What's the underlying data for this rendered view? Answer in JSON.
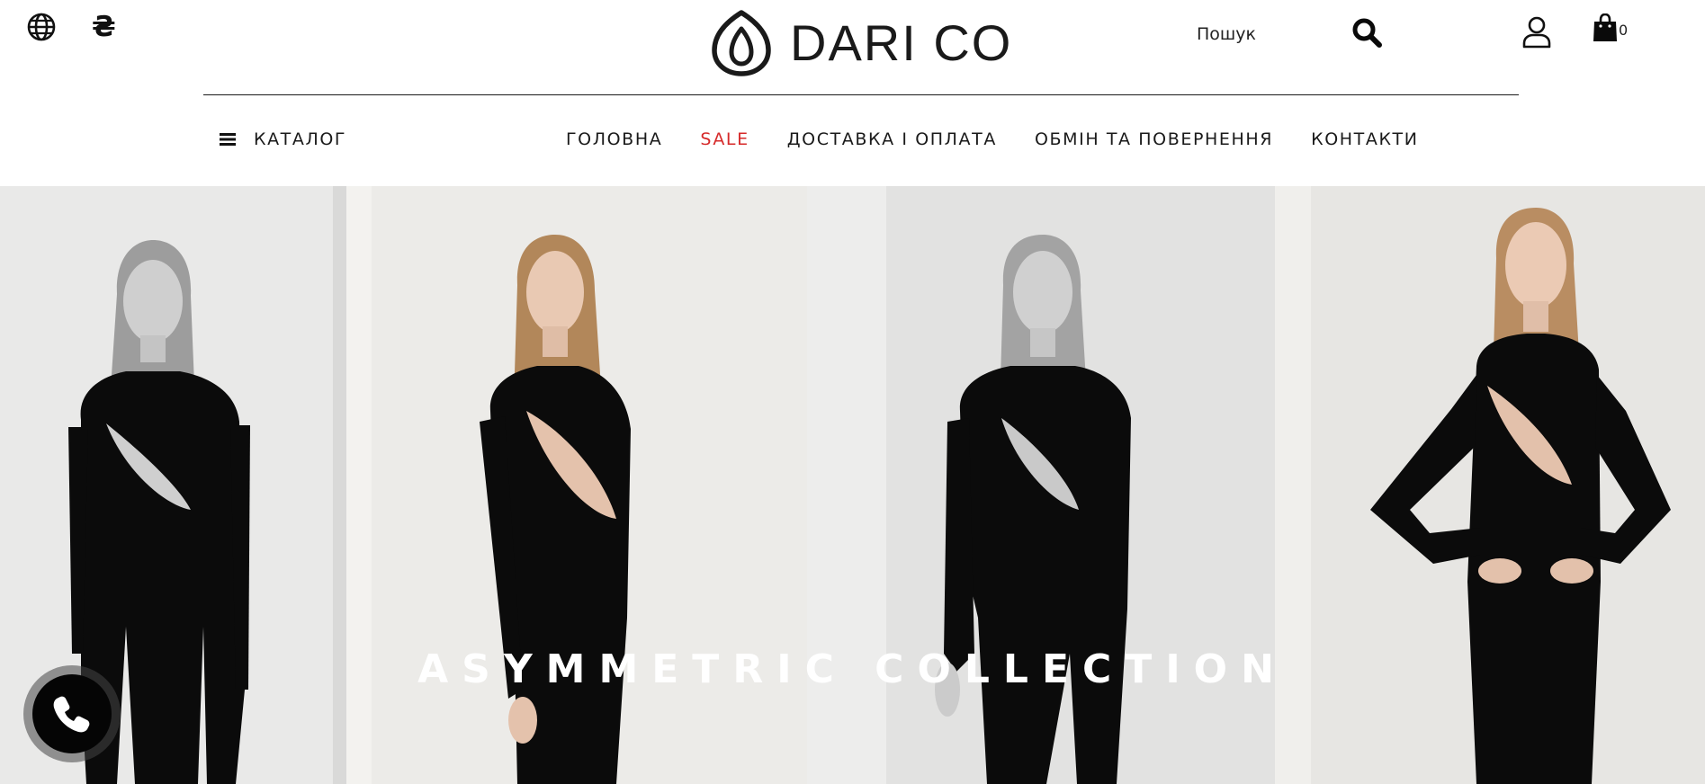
{
  "brand": {
    "name": "DARI CO"
  },
  "header": {
    "language_icon": "globe-icon",
    "currency_symbol": "₴",
    "search_label": "Пошук",
    "cart_count": "0"
  },
  "nav": {
    "catalog_label": "КАТАЛОГ",
    "items": [
      {
        "label": "ГОЛОВНА"
      },
      {
        "label": "SALE",
        "color": "#d62a2a"
      },
      {
        "label": "ДОСТАВКА І ОПЛАТА"
      },
      {
        "label": "ОБМІН ТА ПОВЕРНЕННЯ"
      },
      {
        "label": "КОНТАКТИ"
      }
    ]
  },
  "hero": {
    "title": "ASYMMETRIC COLLECTION",
    "images": [
      {
        "alt": "Model in black asymmetric cut-out bodysuit, black and white photo"
      },
      {
        "alt": "Model in black asymmetric cut-out bodysuit, colour photo"
      },
      {
        "alt": "Model in black asymmetric cut-out bodysuit, black and white photo"
      },
      {
        "alt": "Model in black asymmetric cut-out bodysuit, colour photo"
      }
    ]
  },
  "colors": {
    "accent_sale": "#d62a2a",
    "text": "#1a1a1a",
    "background": "#ffffff"
  },
  "floating": {
    "call_icon": "phone-icon"
  }
}
